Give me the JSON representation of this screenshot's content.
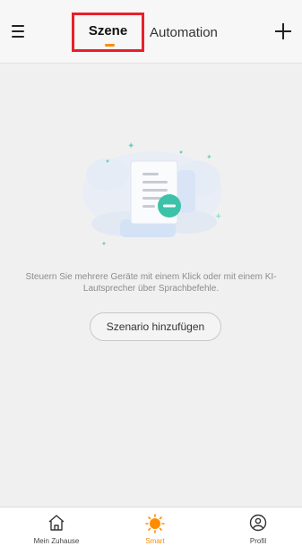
{
  "header": {
    "tabs": [
      {
        "label": "Szene",
        "active": true
      },
      {
        "label": "Automation",
        "active": false
      }
    ],
    "menu_icon": "hamburger-menu-icon",
    "add_icon": "plus-icon"
  },
  "empty_state": {
    "illustration": "document-with-minus-illustration",
    "message": "Steuern Sie mehrere Geräte mit einem Klick oder mit einem KI-Lautsprecher über Sprachbefehle.",
    "button_label": "Szenario hinzufügen"
  },
  "bottom_nav": {
    "items": [
      {
        "label": "Mein Zuhause",
        "icon": "home-icon",
        "active": false
      },
      {
        "label": "Smart",
        "icon": "sun-icon",
        "active": true
      },
      {
        "label": "Profil",
        "icon": "profile-icon",
        "active": false
      }
    ]
  },
  "colors": {
    "accent": "#ff8c00",
    "highlight_box": "#e8202a",
    "illustration_teal": "#3cc2a8",
    "background": "#f0f0f0"
  }
}
